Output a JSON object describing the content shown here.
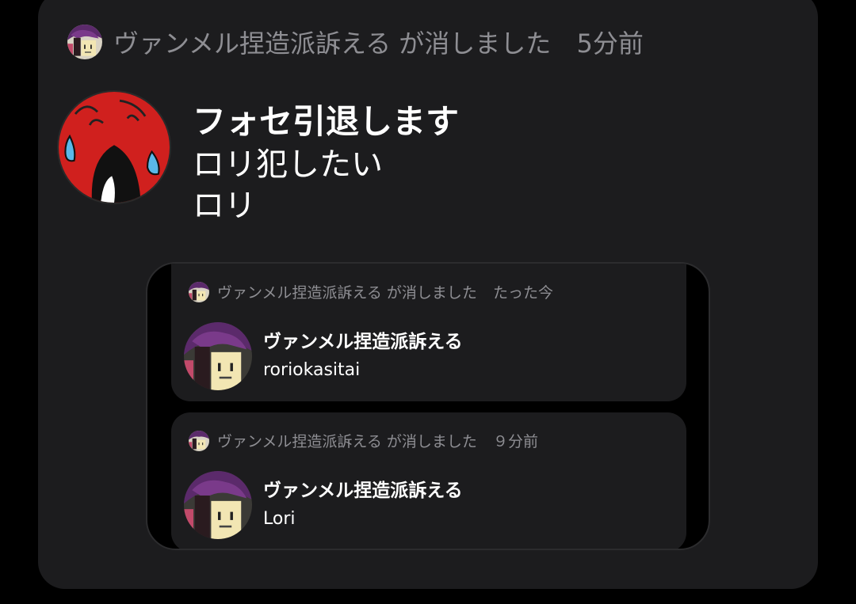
{
  "post": {
    "deleted_notice": {
      "user": "ヴァンメル捏造派訴える",
      "action": "が消しました",
      "time": "5分前"
    },
    "title": "フォセ引退します",
    "lines": [
      "ロリ犯したい",
      "ロリ"
    ]
  },
  "quoted": [
    {
      "deleted_notice": {
        "user": "ヴァンメル捏造派訴える",
        "action": "が消しました",
        "time": "たった今"
      },
      "author": "ヴァンメル捏造派訴える",
      "content": "roriokasitai"
    },
    {
      "deleted_notice": {
        "user": "ヴァンメル捏造派訴える",
        "action": "が消しました",
        "time": "９分前"
      },
      "author": "ヴァンメル捏造派訴える",
      "content": "Lori"
    }
  ],
  "colors": {
    "card_bg": "#1c1c1e",
    "muted_text": "#8e8e93",
    "text": "#ffffff"
  }
}
